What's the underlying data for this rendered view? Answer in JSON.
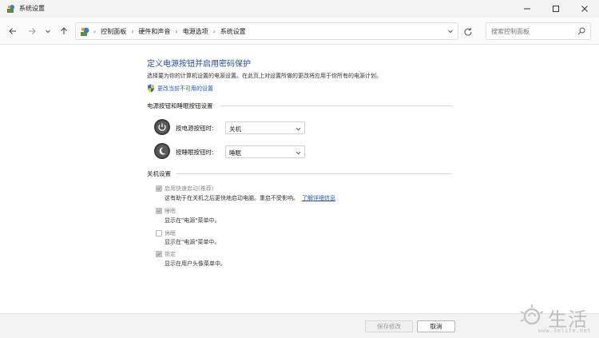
{
  "window": {
    "title": "系统设置"
  },
  "nav": {
    "breadcrumbs": [
      "控制面板",
      "硬件和声音",
      "电源选项",
      "系统设置"
    ],
    "search_placeholder": "搜索控制面板"
  },
  "content": {
    "title": "定义电源按钮并启用密码保护",
    "description": "选择要为你的计算机设置的电源设置。在此页上对设置所做的更改将应用于你所有的电源计划。",
    "change_link": "更改当前不可用的设置",
    "power_section": {
      "heading": "电源按钮和睡眠按钮设置",
      "power_button": {
        "label": "按电源按钮时:",
        "value": "关机"
      },
      "sleep_button": {
        "label": "按睡眠按钮时:",
        "value": "睡眠"
      }
    },
    "shutdown_section": {
      "heading": "关机设置",
      "items": [
        {
          "label": "启用快速启动(推荐)",
          "desc": "这有助于在关机之后更快地启动电脑。重启不受影响。",
          "link": "了解详细信息",
          "checked": true
        },
        {
          "label": "睡眠",
          "desc": "显示在\"电源\"菜单中。",
          "checked": true
        },
        {
          "label": "休眠",
          "desc": "显示在\"电源\"菜单中。",
          "checked": false
        },
        {
          "label": "锁定",
          "desc": "显示在用户头像菜单中。",
          "checked": true
        }
      ]
    }
  },
  "footer": {
    "save_label": "保存修改",
    "cancel_label": "取消"
  },
  "watermark": {
    "text": "生活",
    "url": "www.3elife.net"
  },
  "colors": {
    "title_blue": "#1f4e9a",
    "link_blue": "#1f5bb5",
    "window_bg": "#f3f3f3"
  }
}
